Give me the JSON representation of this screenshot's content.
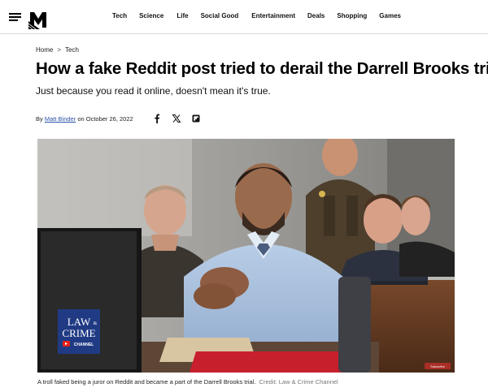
{
  "header": {
    "nav": [
      "Tech",
      "Science",
      "Life",
      "Social Good",
      "Entertainment",
      "Deals",
      "Shopping",
      "Games"
    ]
  },
  "breadcrumb": {
    "home": "Home",
    "separator": ">",
    "section": "Tech"
  },
  "article": {
    "title": "How a fake Reddit post tried to derail the Darrell Brooks trial",
    "subtitle": "Just because you read it online, doesn't mean it's true.",
    "byline_prefix": "By",
    "author": "Matt Binder",
    "date": "on October 26, 2022",
    "share_icons": [
      "facebook-icon",
      "x-icon",
      "flipboard-icon"
    ]
  },
  "image": {
    "watermark_line1": "LAW",
    "watermark_amp": "&",
    "watermark_line2": "CRIME",
    "watermark_line3": "CHANNEL",
    "subscribe_label": "Subscribe"
  },
  "caption": {
    "text": "A troll faked being a juror on Reddit and became a part of the Darrell Brooks trial.",
    "credit": "Credit: Law & Crime Channel"
  },
  "colors": {
    "link": "#2a4fa8",
    "divider": "#d9d9d9",
    "watermark_bg": "#1f3d8c",
    "play_red": "#e62117"
  }
}
